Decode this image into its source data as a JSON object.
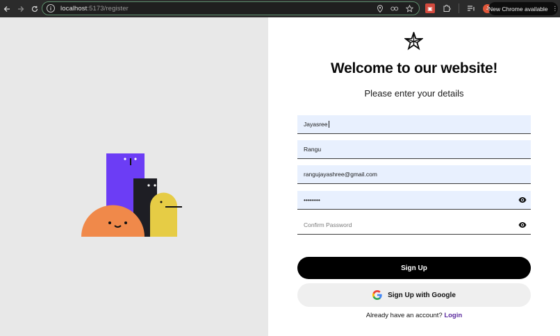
{
  "browser": {
    "url_host": "localhost",
    "url_path": ":5173/register",
    "update_label": "New Chrome available",
    "profile_initial": "J"
  },
  "form": {
    "title": "Welcome to our website!",
    "subtitle": "Please enter your details",
    "first_name_value": "Jayasree",
    "last_name_value": "Rangu",
    "email_value": "rangujayashree@gmail.com",
    "password_masked": "••••••••",
    "confirm_placeholder": "Confirm Password",
    "signup_label": "Sign Up",
    "google_label": "Sign Up with Google",
    "login_prompt": "Already have an account?",
    "login_link": "Login"
  },
  "colors": {
    "accent_link": "#5b2a9e",
    "input_fill": "#e8f0fe",
    "left_bg": "#e8e8e8",
    "purple": "#6c3df5",
    "orange": "#f0894a",
    "yellow": "#e6cc45",
    "dark": "#1e1e24"
  }
}
